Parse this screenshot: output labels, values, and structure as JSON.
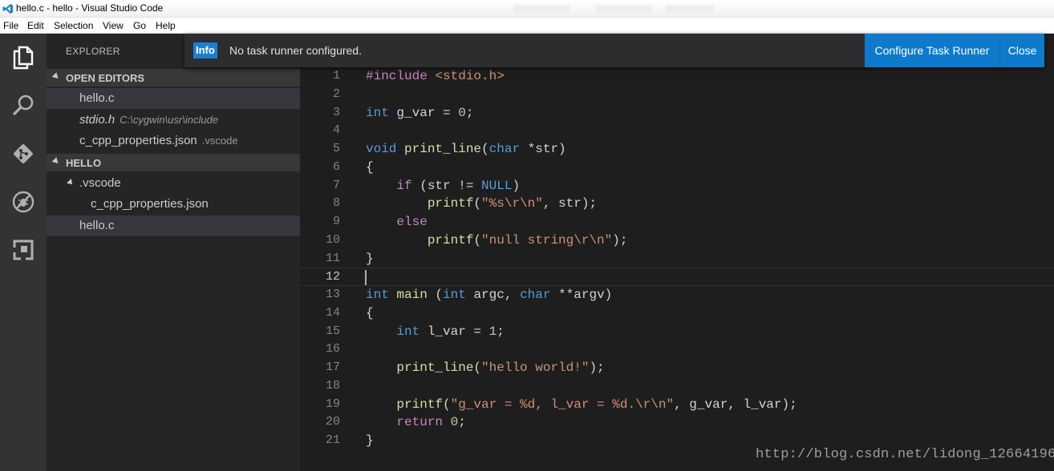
{
  "window": {
    "title": "hello.c - hello - Visual Studio Code"
  },
  "menu": {
    "items": [
      {
        "label": "File"
      },
      {
        "label": "Edit"
      },
      {
        "label": "Selection"
      },
      {
        "label": "View"
      },
      {
        "label": "Go"
      },
      {
        "label": "Help"
      }
    ]
  },
  "activity": {
    "icons": [
      "files-icon",
      "search-icon",
      "git-icon",
      "debug-icon",
      "extensions-icon"
    ]
  },
  "sidebar": {
    "title": "EXPLORER",
    "open_editors": {
      "header": "OPEN EDITORS",
      "items": [
        {
          "name": "hello.c",
          "desc": ""
        },
        {
          "name": "stdio.h",
          "desc": "C:\\cygwin\\usr\\include"
        },
        {
          "name": "c_cpp_properties.json",
          "desc": ".vscode"
        }
      ]
    },
    "workspace": {
      "header": "HELLO",
      "folder": ".vscode",
      "folder_children": [
        "c_cpp_properties.json"
      ],
      "files": [
        "hello.c"
      ]
    }
  },
  "notification": {
    "badge": "Info",
    "message": "No task runner configured.",
    "primary_button": "Configure Task Runner",
    "close_button": "Close"
  },
  "editor": {
    "current_line": 12,
    "lines": [
      {
        "n": "1",
        "text": "#include <stdio.h>"
      },
      {
        "n": "2",
        "text": ""
      },
      {
        "n": "3",
        "text": "int g_var = 0;"
      },
      {
        "n": "4",
        "text": ""
      },
      {
        "n": "5",
        "text": "void print_line(char *str)"
      },
      {
        "n": "6",
        "text": "{"
      },
      {
        "n": "7",
        "text": "    if (str != NULL)"
      },
      {
        "n": "8",
        "text": "        printf(\"%s\\r\\n\", str);"
      },
      {
        "n": "9",
        "text": "    else"
      },
      {
        "n": "10",
        "text": "        printf(\"null string\\r\\n\");"
      },
      {
        "n": "11",
        "text": "}"
      },
      {
        "n": "12",
        "text": ""
      },
      {
        "n": "13",
        "text": "int main (int argc, char **argv)"
      },
      {
        "n": "14",
        "text": "{"
      },
      {
        "n": "15",
        "text": "    int l_var = 1;"
      },
      {
        "n": "16",
        "text": ""
      },
      {
        "n": "17",
        "text": "    print_line(\"hello world!\");"
      },
      {
        "n": "18",
        "text": ""
      },
      {
        "n": "19",
        "text": "    printf(\"g_var = %d, l_var = %d.\\r\\n\", g_var, l_var);"
      },
      {
        "n": "20",
        "text": "    return 0;"
      },
      {
        "n": "21",
        "text": "}"
      }
    ]
  },
  "watermark": "http://blog.csdn.net/lidong_12664196",
  "colors": {
    "accent": "#0e7acc",
    "badge": "#1b80d3",
    "activitybar": "#333333",
    "sidebar": "#252526",
    "editor": "#1e1e1e"
  }
}
